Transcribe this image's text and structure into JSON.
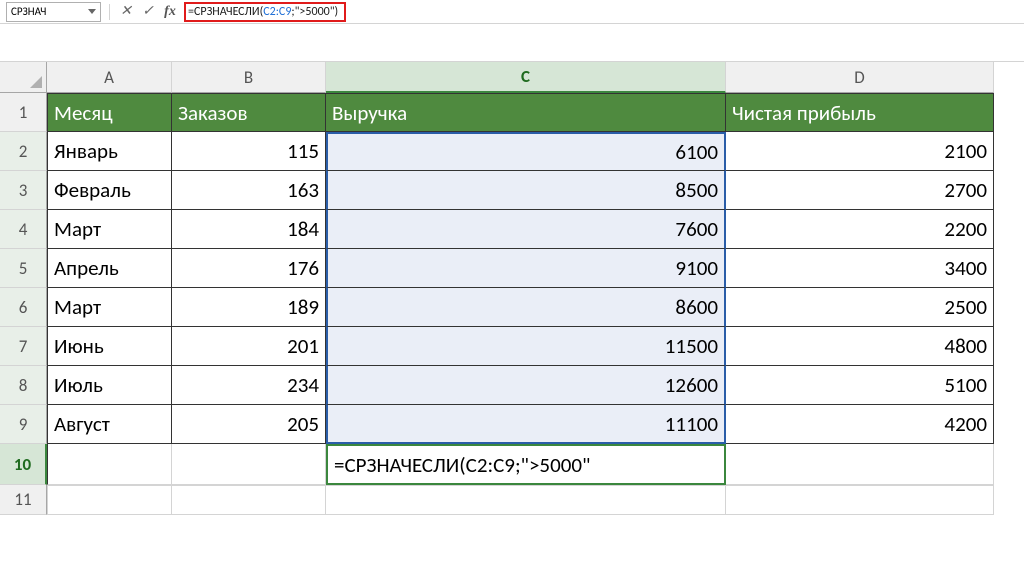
{
  "name_box": "СРЗНАЧ",
  "formula_bar": {
    "prefix": "=СРЗНАЧЕСЛИ(",
    "range": "C2:C9",
    "suffix": ";\">5000\")"
  },
  "columns": [
    "A",
    "B",
    "C",
    "D"
  ],
  "active_col": "C",
  "row_numbers": [
    "1",
    "2",
    "3",
    "4",
    "5",
    "6",
    "7",
    "8",
    "9",
    "10",
    "11"
  ],
  "active_row": "10",
  "headers": [
    "Месяц",
    "Заказов",
    "Выручка",
    "Чистая прибыль"
  ],
  "data": [
    {
      "m": "Январь",
      "o": "115",
      "r": "6100",
      "p": "2100"
    },
    {
      "m": "Февраль",
      "o": "163",
      "r": "8500",
      "p": "2700"
    },
    {
      "m": "Март",
      "o": "184",
      "r": "7600",
      "p": "2200"
    },
    {
      "m": "Апрель",
      "o": "176",
      "r": "9100",
      "p": "3400"
    },
    {
      "m": "Март",
      "o": "189",
      "r": "8600",
      "p": "2500"
    },
    {
      "m": "Июнь",
      "o": "201",
      "r": "11500",
      "p": "4800"
    },
    {
      "m": "Июль",
      "o": "234",
      "r": "12600",
      "p": "5100"
    },
    {
      "m": "Август",
      "o": "205",
      "r": "11100",
      "p": "4200"
    }
  ],
  "editing_cell": "=СРЗНАЧЕСЛИ(C2:C9;\">5000\""
}
